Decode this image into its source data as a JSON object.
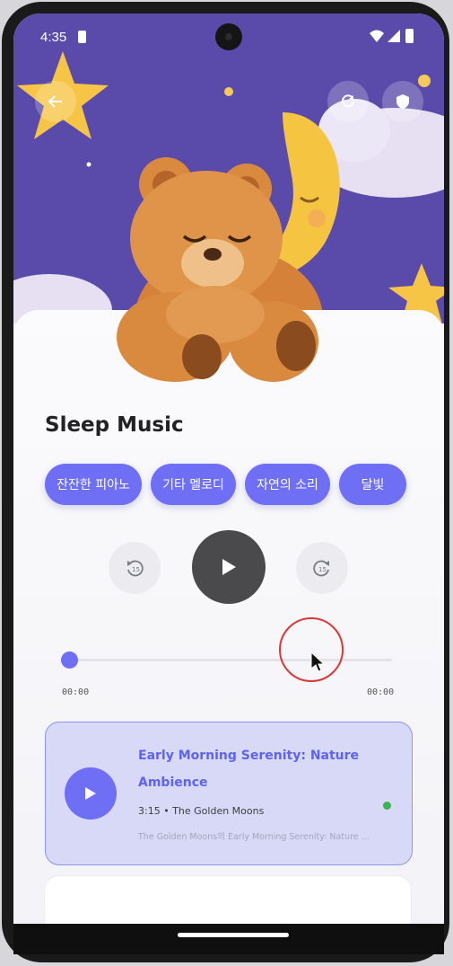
{
  "status_bar": {
    "time": "4:35"
  },
  "app": {
    "title": "Sleep Music",
    "categories": [
      "잔잔한 피아노",
      "기타 멜로디",
      "자연의 소리",
      "달빛"
    ],
    "colors": {
      "accent": "#6f6ff6",
      "hero_bg": "#5a4bab",
      "card_bg": "#d7d9f6",
      "active_dot": "#36b64e"
    }
  },
  "player": {
    "position_fraction": 0.0,
    "elapsed": "00:00",
    "duration": "00:00",
    "icons": {
      "rewind": "replay-15-icon",
      "play": "play-icon",
      "forward": "forward-15-icon"
    }
  },
  "tracks": [
    {
      "title": "Early Morning Serenity: Nature Ambience",
      "length": "3:15",
      "artist": "The Golden Moons",
      "description": "The Golden Moons의 Early Morning Serenity: Nature ..."
    }
  ],
  "track_meta_separator": "•"
}
